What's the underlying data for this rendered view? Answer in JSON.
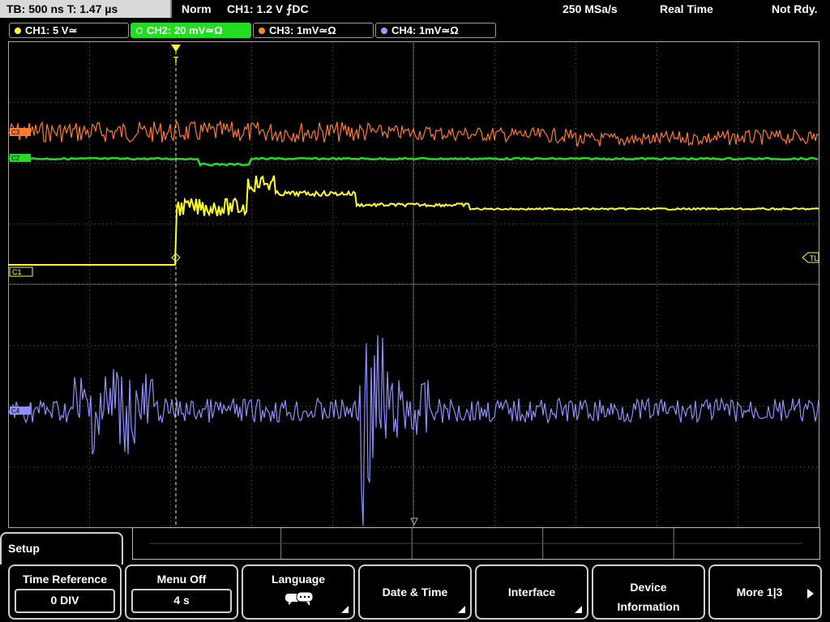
{
  "top": {
    "timebase": "TB: 500 ns   T: 1.47 µs",
    "mode": "Norm",
    "trigger": "CH1: 1.2 V ⨍DC",
    "sample_rate": "250 MSa/s",
    "acquisition": "Real Time",
    "status": "Not Rdy."
  },
  "channels": [
    {
      "label": "CH1: 5 V≃",
      "color": "#ffff33",
      "active": false
    },
    {
      "label": "CH2: 20 mV≃Ω",
      "color": "#22dd22",
      "active": true
    },
    {
      "label": "CH3: 1mV≃Ω",
      "color": "#ff8833",
      "active": false
    },
    {
      "label": "CH4: 1mV≃Ω",
      "color": "#9999ff",
      "active": false
    }
  ],
  "markers": {
    "c1": "C1",
    "c2": "C2",
    "c3": "C3",
    "c4": "C4",
    "tl": "TL",
    "trig": "T"
  },
  "menu": {
    "title": "Setup",
    "time_reference": {
      "label": "Time Reference",
      "value": "0 DIV"
    },
    "menu_off": {
      "label": "Menu Off",
      "value": "4 s"
    },
    "language": {
      "label": "Language"
    },
    "date_time": {
      "label": "Date & Time"
    },
    "interface": {
      "label": "Interface"
    },
    "device_info": {
      "line1": "Device",
      "line2": "Information"
    },
    "more": {
      "label": "More 1|3"
    }
  }
}
